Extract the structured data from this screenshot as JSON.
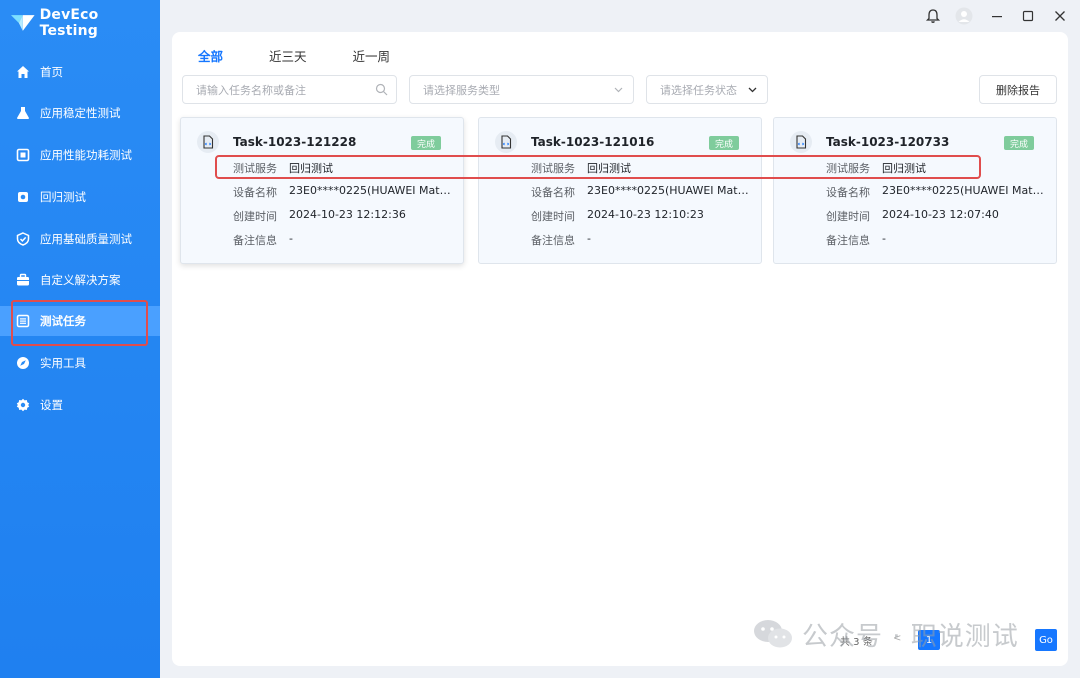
{
  "app": {
    "name": "DevEco Testing"
  },
  "sidebar": {
    "items": [
      {
        "label": "首页",
        "icon": "home-icon"
      },
      {
        "label": "应用稳定性测试",
        "icon": "flask-icon"
      },
      {
        "label": "应用性能功耗测试",
        "icon": "chip-icon"
      },
      {
        "label": "回归测试",
        "icon": "regression-icon"
      },
      {
        "label": "应用基础质量测试",
        "icon": "shield-check-icon"
      },
      {
        "label": "自定义解决方案",
        "icon": "briefcase-icon"
      },
      {
        "label": "测试任务",
        "icon": "task-list-icon",
        "active": true
      },
      {
        "label": "实用工具",
        "icon": "compass-icon"
      },
      {
        "label": "设置",
        "icon": "gear-icon"
      }
    ]
  },
  "tabs": [
    {
      "label": "全部",
      "active": true
    },
    {
      "label": "近三天"
    },
    {
      "label": "近一周"
    }
  ],
  "filters": {
    "search_placeholder": "请输入任务名称或备注",
    "service_placeholder": "请选择服务类型",
    "status_placeholder": "请选择任务状态",
    "delete_label": "删除报告"
  },
  "labels": {
    "service": "测试服务",
    "device": "设备名称",
    "created": "创建时间",
    "note": "备注信息"
  },
  "cards": [
    {
      "title": "Task-1023-121228",
      "status": "完成",
      "service": "回归测试",
      "device": "23E0****0225(HUAWEI Mate...",
      "created": "2024-10-23 12:12:36",
      "note": "-"
    },
    {
      "title": "Task-1023-121016",
      "status": "完成",
      "service": "回归测试",
      "device": "23E0****0225(HUAWEI Mate...",
      "created": "2024-10-23 12:10:23",
      "note": "-"
    },
    {
      "title": "Task-1023-120733",
      "status": "完成",
      "service": "回归测试",
      "device": "23E0****0225(HUAWEI Mate...",
      "created": "2024-10-23 12:07:40",
      "note": "-"
    }
  ],
  "pagination": {
    "total": "共 3 条",
    "page": "1",
    "go": "Go",
    "prev": "<"
  },
  "watermark": {
    "text": "公众号 · 职说测试"
  },
  "colors": {
    "primary": "#1677ff",
    "sidebar": "#2a8cf5",
    "badge": "#7fcc9c",
    "highlight": "#e04d4d"
  }
}
